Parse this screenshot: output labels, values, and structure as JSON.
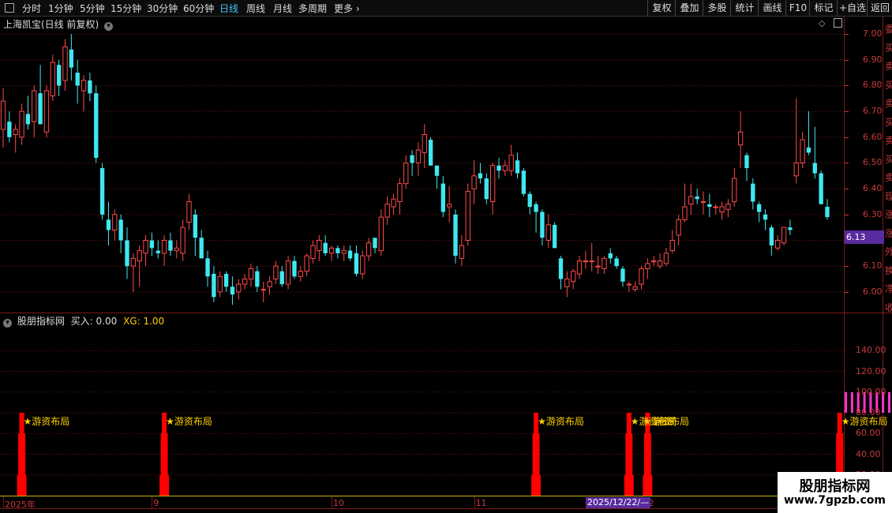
{
  "toolbar": {
    "periods": [
      {
        "label": "分时",
        "active": false
      },
      {
        "label": "1分钟",
        "active": false
      },
      {
        "label": "5分钟",
        "active": false
      },
      {
        "label": "15分钟",
        "active": false
      },
      {
        "label": "30分钟",
        "active": false
      },
      {
        "label": "60分钟",
        "active": false
      },
      {
        "label": "日线",
        "active": true
      },
      {
        "label": "周线",
        "active": false
      },
      {
        "label": "月线",
        "active": false
      },
      {
        "label": "多周期",
        "active": false
      },
      {
        "label": "更多",
        "active": false
      }
    ],
    "right_buttons": [
      "复权",
      "叠加",
      "多股",
      "统计",
      "画线",
      "F10",
      "标记",
      "+自选",
      "返回"
    ]
  },
  "main_panel": {
    "title": "上海凯宝(日线 前复权)",
    "current_price": "6.13",
    "y_ticks": [
      "7.00",
      "6.90",
      "6.80",
      "6.70",
      "6.60",
      "6.50",
      "6.40",
      "6.30",
      "6.20",
      "6.10",
      "6.00"
    ]
  },
  "indicator_panel": {
    "name": "股朋指标网",
    "buy_label": "买入: 0.00",
    "xg_label": "XG: 1.00",
    "y_ticks": [
      "140.00",
      "120.00",
      "100.00",
      "80.00",
      "60.00",
      "40.00",
      "20.00"
    ],
    "signal_text": "★游资布局",
    "overlap_text": "★游资布局",
    "overlap_extra": "游资"
  },
  "x_axis": {
    "labels": [
      "2025年",
      "9",
      "10",
      "11",
      "12",
      "2"
    ],
    "cursor_date": "2025/12/22/—"
  },
  "watermark": {
    "title": "股朋指标网",
    "url": "www.7gpzb.com"
  },
  "right_column_chars": [
    "委",
    "买",
    "卖",
    "买",
    "卖",
    "买",
    "卖",
    "买",
    "卖",
    "现",
    "涨",
    "涨",
    "外",
    "换",
    "净",
    "收"
  ],
  "colors": {
    "up": "#ff4a4a",
    "down": "#3fe8f0",
    "grid": "#7a1a1a",
    "signal_bar": "#ff0000",
    "pink_bar": "#ff33cc",
    "signal_text": "#ffd000",
    "active_tab": "#39c6ff",
    "price_tag": "#5a2b9e"
  },
  "chart_data": {
    "type": "candlestick",
    "ylim": [
      5.92,
      7.04
    ],
    "candles": [
      {
        "o": 6.63,
        "h": 6.79,
        "l": 6.56,
        "c": 6.74
      },
      {
        "o": 6.66,
        "h": 6.7,
        "l": 6.58,
        "c": 6.6
      },
      {
        "o": 6.61,
        "h": 6.65,
        "l": 6.54,
        "c": 6.63
      },
      {
        "o": 6.6,
        "h": 6.73,
        "l": 6.57,
        "c": 6.7
      },
      {
        "o": 6.69,
        "h": 6.76,
        "l": 6.63,
        "c": 6.65
      },
      {
        "o": 6.66,
        "h": 6.8,
        "l": 6.6,
        "c": 6.78
      },
      {
        "o": 6.77,
        "h": 6.88,
        "l": 6.7,
        "c": 6.65
      },
      {
        "o": 6.62,
        "h": 6.8,
        "l": 6.6,
        "c": 6.78
      },
      {
        "o": 6.76,
        "h": 6.92,
        "l": 6.74,
        "c": 6.89
      },
      {
        "o": 6.88,
        "h": 6.9,
        "l": 6.76,
        "c": 6.8
      },
      {
        "o": 6.82,
        "h": 6.98,
        "l": 6.78,
        "c": 6.95
      },
      {
        "o": 6.94,
        "h": 7.0,
        "l": 6.82,
        "c": 6.87
      },
      {
        "o": 6.85,
        "h": 6.9,
        "l": 6.73,
        "c": 6.8
      },
      {
        "o": 6.78,
        "h": 6.84,
        "l": 6.7,
        "c": 6.82
      },
      {
        "o": 6.82,
        "h": 6.85,
        "l": 6.74,
        "c": 6.77
      },
      {
        "o": 6.77,
        "h": 6.8,
        "l": 6.5,
        "c": 6.52
      },
      {
        "o": 6.48,
        "h": 6.5,
        "l": 6.28,
        "c": 6.3
      },
      {
        "o": 6.28,
        "h": 6.35,
        "l": 6.18,
        "c": 6.24
      },
      {
        "o": 6.24,
        "h": 6.32,
        "l": 6.2,
        "c": 6.3
      },
      {
        "o": 6.28,
        "h": 6.3,
        "l": 6.15,
        "c": 6.2
      },
      {
        "o": 6.2,
        "h": 6.25,
        "l": 6.05,
        "c": 6.1
      },
      {
        "o": 6.1,
        "h": 6.15,
        "l": 6.0,
        "c": 6.13
      },
      {
        "o": 6.12,
        "h": 6.18,
        "l": 6.02,
        "c": 6.16
      },
      {
        "o": 6.15,
        "h": 6.22,
        "l": 6.1,
        "c": 6.2
      },
      {
        "o": 6.2,
        "h": 6.23,
        "l": 6.14,
        "c": 6.17
      },
      {
        "o": 6.16,
        "h": 6.2,
        "l": 6.13,
        "c": 6.15
      },
      {
        "o": 6.15,
        "h": 6.22,
        "l": 6.1,
        "c": 6.2
      },
      {
        "o": 6.2,
        "h": 6.23,
        "l": 6.14,
        "c": 6.16
      },
      {
        "o": 6.16,
        "h": 6.2,
        "l": 6.13,
        "c": 6.17
      },
      {
        "o": 6.15,
        "h": 6.28,
        "l": 6.12,
        "c": 6.25
      },
      {
        "o": 6.27,
        "h": 6.38,
        "l": 6.24,
        "c": 6.35
      },
      {
        "o": 6.3,
        "h": 6.32,
        "l": 6.14,
        "c": 6.21
      },
      {
        "o": 6.21,
        "h": 6.24,
        "l": 6.13,
        "c": 6.13
      },
      {
        "o": 6.13,
        "h": 6.16,
        "l": 6.02,
        "c": 6.06
      },
      {
        "o": 6.07,
        "h": 6.1,
        "l": 5.96,
        "c": 5.98
      },
      {
        "o": 6.0,
        "h": 6.08,
        "l": 5.98,
        "c": 6.06
      },
      {
        "o": 6.07,
        "h": 6.08,
        "l": 6.0,
        "c": 6.02
      },
      {
        "o": 6.02,
        "h": 6.06,
        "l": 5.95,
        "c": 5.99
      },
      {
        "o": 6.0,
        "h": 6.05,
        "l": 5.97,
        "c": 6.03
      },
      {
        "o": 6.03,
        "h": 6.07,
        "l": 6.01,
        "c": 6.05
      },
      {
        "o": 6.05,
        "h": 6.11,
        "l": 6.02,
        "c": 6.09
      },
      {
        "o": 6.08,
        "h": 6.1,
        "l": 6.0,
        "c": 6.02
      },
      {
        "o": 6.01,
        "h": 6.04,
        "l": 5.96,
        "c": 6.01
      },
      {
        "o": 6.02,
        "h": 6.06,
        "l": 5.99,
        "c": 6.04
      },
      {
        "o": 6.05,
        "h": 6.12,
        "l": 6.03,
        "c": 6.1
      },
      {
        "o": 6.08,
        "h": 6.1,
        "l": 6.02,
        "c": 6.03
      },
      {
        "o": 6.03,
        "h": 6.14,
        "l": 6.01,
        "c": 6.12
      },
      {
        "o": 6.12,
        "h": 6.14,
        "l": 6.05,
        "c": 6.06
      },
      {
        "o": 6.06,
        "h": 6.1,
        "l": 6.04,
        "c": 6.08
      },
      {
        "o": 6.08,
        "h": 6.15,
        "l": 6.06,
        "c": 6.14
      },
      {
        "o": 6.13,
        "h": 6.2,
        "l": 6.11,
        "c": 6.18
      },
      {
        "o": 6.16,
        "h": 6.22,
        "l": 6.12,
        "c": 6.2
      },
      {
        "o": 6.19,
        "h": 6.22,
        "l": 6.14,
        "c": 6.15
      },
      {
        "o": 6.15,
        "h": 6.18,
        "l": 6.12,
        "c": 6.17
      },
      {
        "o": 6.17,
        "h": 6.18,
        "l": 6.13,
        "c": 6.15
      },
      {
        "o": 6.15,
        "h": 6.18,
        "l": 6.12,
        "c": 6.16
      },
      {
        "o": 6.16,
        "h": 6.18,
        "l": 6.12,
        "c": 6.13
      },
      {
        "o": 6.15,
        "h": 6.18,
        "l": 6.06,
        "c": 6.07
      },
      {
        "o": 6.07,
        "h": 6.16,
        "l": 6.05,
        "c": 6.14
      },
      {
        "o": 6.14,
        "h": 6.21,
        "l": 6.12,
        "c": 6.19
      },
      {
        "o": 6.21,
        "h": 6.2,
        "l": 6.15,
        "c": 6.17
      },
      {
        "o": 6.16,
        "h": 6.32,
        "l": 6.14,
        "c": 6.29
      },
      {
        "o": 6.29,
        "h": 6.37,
        "l": 6.26,
        "c": 6.34
      },
      {
        "o": 6.33,
        "h": 6.38,
        "l": 6.3,
        "c": 6.36
      },
      {
        "o": 6.35,
        "h": 6.44,
        "l": 6.3,
        "c": 6.42
      },
      {
        "o": 6.42,
        "h": 6.53,
        "l": 6.4,
        "c": 6.5
      },
      {
        "o": 6.53,
        "h": 6.55,
        "l": 6.45,
        "c": 6.5
      },
      {
        "o": 6.5,
        "h": 6.58,
        "l": 6.45,
        "c": 6.55
      },
      {
        "o": 6.54,
        "h": 6.65,
        "l": 6.48,
        "c": 6.61
      },
      {
        "o": 6.59,
        "h": 6.6,
        "l": 6.49,
        "c": 6.49
      },
      {
        "o": 6.49,
        "h": 6.48,
        "l": 6.4,
        "c": 6.45
      },
      {
        "o": 6.42,
        "h": 6.45,
        "l": 6.29,
        "c": 6.31
      },
      {
        "o": 6.33,
        "h": 6.41,
        "l": 6.27,
        "c": 6.34
      },
      {
        "o": 6.3,
        "h": 6.32,
        "l": 6.11,
        "c": 6.14
      },
      {
        "o": 6.13,
        "h": 6.22,
        "l": 6.1,
        "c": 6.18
      },
      {
        "o": 6.2,
        "h": 6.42,
        "l": 6.18,
        "c": 6.39
      },
      {
        "o": 6.4,
        "h": 6.51,
        "l": 6.34,
        "c": 6.45
      },
      {
        "o": 6.46,
        "h": 6.5,
        "l": 6.42,
        "c": 6.44
      },
      {
        "o": 6.44,
        "h": 6.46,
        "l": 6.34,
        "c": 6.36
      },
      {
        "o": 6.35,
        "h": 6.5,
        "l": 6.3,
        "c": 6.49
      },
      {
        "o": 6.49,
        "h": 6.52,
        "l": 6.44,
        "c": 6.47
      },
      {
        "o": 6.47,
        "h": 6.51,
        "l": 6.45,
        "c": 6.49
      },
      {
        "o": 6.47,
        "h": 6.57,
        "l": 6.45,
        "c": 6.53
      },
      {
        "o": 6.51,
        "h": 6.54,
        "l": 6.44,
        "c": 6.46
      },
      {
        "o": 6.47,
        "h": 6.48,
        "l": 6.37,
        "c": 6.38
      },
      {
        "o": 6.38,
        "h": 6.39,
        "l": 6.3,
        "c": 6.33
      },
      {
        "o": 6.34,
        "h": 6.35,
        "l": 6.23,
        "c": 6.31
      },
      {
        "o": 6.31,
        "h": 6.32,
        "l": 6.18,
        "c": 6.21
      },
      {
        "o": 6.2,
        "h": 6.3,
        "l": 6.17,
        "c": 6.26
      },
      {
        "o": 6.26,
        "h": 6.27,
        "l": 6.17,
        "c": 6.17
      },
      {
        "o": 6.13,
        "h": 6.14,
        "l": 6.01,
        "c": 6.05
      },
      {
        "o": 6.02,
        "h": 6.08,
        "l": 5.98,
        "c": 6.05
      },
      {
        "o": 6.04,
        "h": 6.09,
        "l": 6.01,
        "c": 6.08
      },
      {
        "o": 6.07,
        "h": 6.14,
        "l": 6.05,
        "c": 6.12
      },
      {
        "o": 6.12,
        "h": 6.16,
        "l": 6.09,
        "c": 6.12
      },
      {
        "o": 6.12,
        "h": 6.19,
        "l": 6.08,
        "c": 6.12
      },
      {
        "o": 6.1,
        "h": 6.14,
        "l": 6.07,
        "c": 6.1
      },
      {
        "o": 6.09,
        "h": 6.14,
        "l": 6.07,
        "c": 6.13
      },
      {
        "o": 6.15,
        "h": 6.17,
        "l": 6.11,
        "c": 6.13
      },
      {
        "o": 6.13,
        "h": 6.14,
        "l": 6.09,
        "c": 6.1
      },
      {
        "o": 6.09,
        "h": 6.1,
        "l": 6.02,
        "c": 6.04
      },
      {
        "o": 6.03,
        "h": 6.04,
        "l": 6.0,
        "c": 6.03
      },
      {
        "o": 6.01,
        "h": 6.04,
        "l": 6.0,
        "c": 6.02
      },
      {
        "o": 6.03,
        "h": 6.1,
        "l": 6.01,
        "c": 6.09
      },
      {
        "o": 6.09,
        "h": 6.13,
        "l": 6.05,
        "c": 6.11
      },
      {
        "o": 6.12,
        "h": 6.14,
        "l": 6.1,
        "c": 6.12
      },
      {
        "o": 6.1,
        "h": 6.15,
        "l": 6.09,
        "c": 6.12
      },
      {
        "o": 6.11,
        "h": 6.17,
        "l": 6.1,
        "c": 6.15
      },
      {
        "o": 6.16,
        "h": 6.24,
        "l": 6.15,
        "c": 6.2
      },
      {
        "o": 6.22,
        "h": 6.3,
        "l": 6.18,
        "c": 6.28
      },
      {
        "o": 6.28,
        "h": 6.42,
        "l": 6.27,
        "c": 6.33
      },
      {
        "o": 6.34,
        "h": 6.42,
        "l": 6.3,
        "c": 6.37
      },
      {
        "o": 6.37,
        "h": 6.4,
        "l": 6.34,
        "c": 6.36
      },
      {
        "o": 6.35,
        "h": 6.39,
        "l": 6.3,
        "c": 6.35
      },
      {
        "o": 6.34,
        "h": 6.38,
        "l": 6.29,
        "c": 6.33
      },
      {
        "o": 6.33,
        "h": 6.34,
        "l": 6.3,
        "c": 6.33
      },
      {
        "o": 6.31,
        "h": 6.35,
        "l": 6.28,
        "c": 6.33
      },
      {
        "o": 6.32,
        "h": 6.36,
        "l": 6.29,
        "c": 6.34
      },
      {
        "o": 6.35,
        "h": 6.48,
        "l": 6.33,
        "c": 6.44
      },
      {
        "o": 6.57,
        "h": 6.7,
        "l": 6.48,
        "c": 6.62
      },
      {
        "o": 6.53,
        "h": 6.54,
        "l": 6.43,
        "c": 6.48
      },
      {
        "o": 6.42,
        "h": 6.44,
        "l": 6.32,
        "c": 6.35
      },
      {
        "o": 6.34,
        "h": 6.35,
        "l": 6.27,
        "c": 6.31
      },
      {
        "o": 6.3,
        "h": 6.32,
        "l": 6.24,
        "c": 6.28
      },
      {
        "o": 6.25,
        "h": 6.26,
        "l": 6.14,
        "c": 6.18
      },
      {
        "o": 6.17,
        "h": 6.22,
        "l": 6.16,
        "c": 6.2
      },
      {
        "o": 6.19,
        "h": 6.25,
        "l": 6.18,
        "c": 6.25
      },
      {
        "o": 6.25,
        "h": 6.28,
        "l": 6.22,
        "c": 6.24
      },
      {
        "o": 6.45,
        "h": 6.75,
        "l": 6.42,
        "c": 6.5
      },
      {
        "o": 6.5,
        "h": 6.62,
        "l": 6.48,
        "c": 6.59
      },
      {
        "o": 6.56,
        "h": 6.7,
        "l": 6.53,
        "c": 6.54
      },
      {
        "o": 6.5,
        "h": 6.64,
        "l": 6.44,
        "c": 6.46
      },
      {
        "o": 6.46,
        "h": 6.47,
        "l": 6.34,
        "c": 6.34
      },
      {
        "o": 6.33,
        "h": 6.36,
        "l": 6.28,
        "c": 6.29
      }
    ],
    "indicator": {
      "ylim": [
        0,
        160
      ],
      "signals": [
        {
          "index": 3,
          "value": 80
        },
        {
          "index": 26,
          "value": 80
        },
        {
          "index": 86,
          "value": 80
        },
        {
          "index": 101,
          "value": 80
        },
        {
          "index": 104,
          "value": 80
        },
        {
          "index": 135,
          "value": 80
        }
      ],
      "pink_bars": {
        "from_index": 136,
        "to_index": 143,
        "low": 80,
        "high": 100
      }
    }
  }
}
